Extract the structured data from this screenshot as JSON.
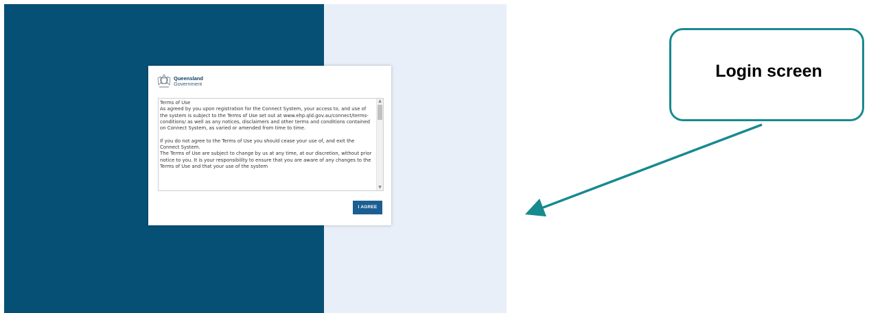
{
  "colors": {
    "left_panel": "#075075",
    "right_panel": "#e9eff8",
    "agree_button": "#1b5f92",
    "callout_border": "#168a8f",
    "arrow": "#168a8f"
  },
  "logo": {
    "icon": "queensland-crest-icon",
    "line1": "Queensland",
    "line2": "Government"
  },
  "terms": {
    "heading": "Terms of Use",
    "paragraph1": "As agreed by you upon registration for the Connect System, your access to, and use of the system is subject to the Terms of Use set out at www.ehp.qld.gov.au/connect/terms-conditions/ as well as any notices, disclaimers and other terms and conditions contained on Connect System, as varied or amended from time to time.",
    "paragraph2": "If you do not agree to the Terms of Use you should cease your use of, and exit the Connect System.",
    "paragraph3": "The Terms of Use are subject to change by us at any time, at our discretion, without prior notice to you.  It is your responsibility to ensure that you are aware of any changes to the Terms of Use and that your use of the system"
  },
  "buttons": {
    "agree_label": "I AGREE"
  },
  "annotation": {
    "callout_label": "Login screen"
  }
}
